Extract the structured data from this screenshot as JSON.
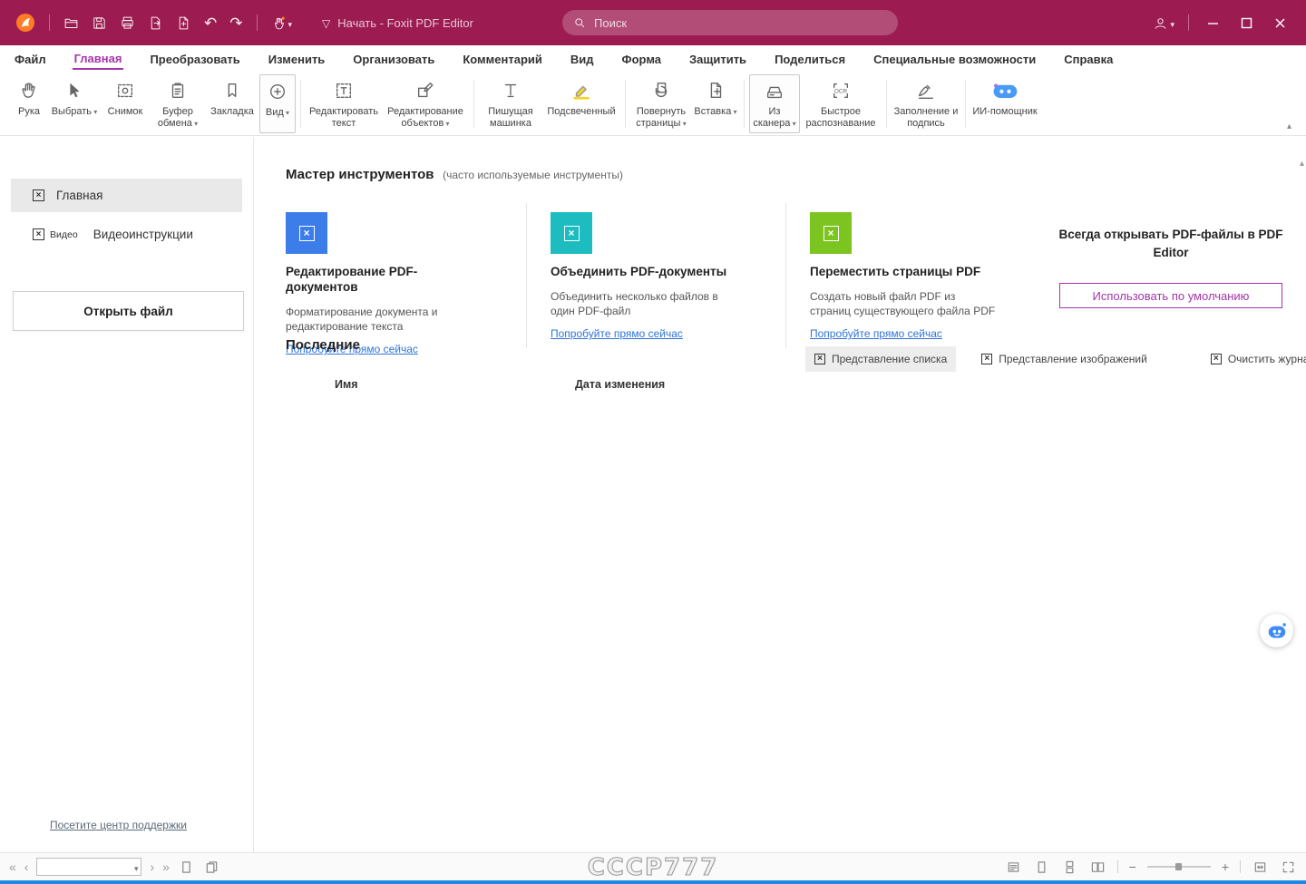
{
  "colors": {
    "titlebar": "#9c1b51",
    "accent": "#a435aa",
    "link": "#2e74d9",
    "card-blue": "#3d7de9",
    "card-teal": "#1cbcc0",
    "card-green": "#7cc41f",
    "strip": "#1e88e5",
    "ai": "#3d8cf5"
  },
  "titlebar": {
    "title": "Начать - Foxit PDF Editor",
    "search_placeholder": "Поиск"
  },
  "menubar": {
    "items": [
      {
        "label": "Файл"
      },
      {
        "label": "Главная",
        "active": true
      },
      {
        "label": "Преобразовать"
      },
      {
        "label": "Изменить"
      },
      {
        "label": "Организовать"
      },
      {
        "label": "Комментарий"
      },
      {
        "label": "Вид"
      },
      {
        "label": "Форма"
      },
      {
        "label": "Защитить"
      },
      {
        "label": "Поделиться"
      },
      {
        "label": "Специальные возможности"
      },
      {
        "label": "Справка"
      }
    ]
  },
  "ribbon": {
    "buttons": [
      {
        "label": "Рука"
      },
      {
        "label": "Выбрать",
        "dropdown": true
      },
      {
        "label": "Снимок"
      },
      {
        "label": "Буфер обмена",
        "dropdown": true
      },
      {
        "label": "Закладка"
      },
      {
        "label": "Вид",
        "dropdown": true
      },
      {
        "label": "Редактировать текст"
      },
      {
        "label": "Редактирование объектов",
        "dropdown": true
      },
      {
        "label": "Пишущая машинка"
      },
      {
        "label": "Подсвеченный"
      },
      {
        "label": "Повернуть страницы",
        "dropdown": true
      },
      {
        "label": "Вставка",
        "dropdown": true
      },
      {
        "label": "Из сканера",
        "dropdown": true
      },
      {
        "label": "Быстрое распознавание"
      },
      {
        "label": "Заполнение и подпись"
      },
      {
        "label": "ИИ-помощник"
      }
    ]
  },
  "sidebar": {
    "home": "Главная",
    "video_small": "Видео",
    "video_label": "Видеоинструкции",
    "open_file": "Открыть файл",
    "support_link": "Посетите центр поддержки"
  },
  "main": {
    "tools_title": "Мастер инструментов",
    "tools_subtitle": "(часто используемые инструменты)",
    "cards": [
      {
        "title": "Редактирование PDF-документов",
        "desc": "Форматирование документа и редактирование текста",
        "link": "Попробуйте прямо сейчас"
      },
      {
        "title": "Объединить PDF-документы",
        "desc": "Объединить несколько файлов в один PDF-файл",
        "link": "Попробуйте прямо сейчас"
      },
      {
        "title": "Переместить страницы PDF",
        "desc": "Создать новый файл PDF из страниц существующего файла PDF",
        "link": "Попробуйте прямо сейчас"
      }
    ],
    "default_panel": {
      "title": "Всегда открывать PDF-файлы в PDF Editor",
      "button": "Использовать по умолчанию"
    },
    "recent": {
      "title": "Последние",
      "view_list": "Представление списка",
      "view_images": "Представление изображений",
      "clear_history": "Очистить журнал файлов",
      "col_name": "Имя",
      "col_date": "Дата изменения"
    }
  },
  "statusbar": {
    "watermark": "CCCP777"
  }
}
